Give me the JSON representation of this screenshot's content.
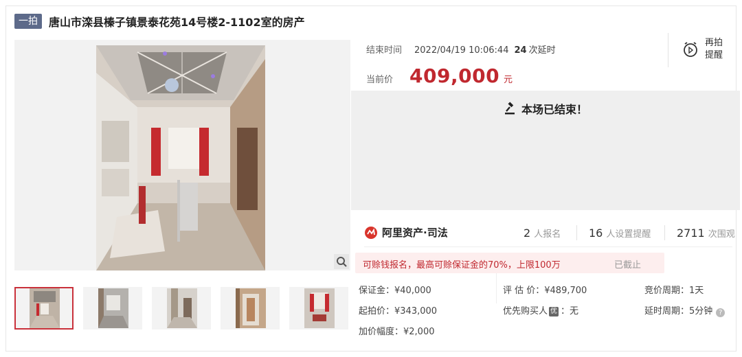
{
  "header": {
    "round_badge": "一拍",
    "title": "唐山市滦县榛子镇景泰花苑14号楼2-1102室的房产"
  },
  "gallery": {
    "thumbnail_count": 5,
    "selected_thumbnail": 1
  },
  "auction": {
    "end_label": "结束时间",
    "end_time": "2022/04/19 10:06:44",
    "delay_count": "24",
    "delay_label": "次延时",
    "price_label": "当前价",
    "price_value": "409,000",
    "price_unit": "元",
    "reminder_label": "再拍提醒",
    "ended_text": "本场已结束！"
  },
  "platform": {
    "name": "阿里资产·司法"
  },
  "stats": [
    {
      "value": "2",
      "label": "人报名"
    },
    {
      "value": "16",
      "label": "人设置提醒"
    },
    {
      "value": "2711",
      "label": "次围观"
    }
  ],
  "notice": {
    "text": "可赊钱报名，最高可赊保证金的70%，上限100万",
    "status": "已截止"
  },
  "details": {
    "deposit": "保证金：¥40,000",
    "appraisal": "评 估 价：¥489,700",
    "cycle": "竞价周期：1天",
    "starting_price": "起拍价：¥343,000",
    "priority_label": "优先购买人",
    "priority_badge": "优",
    "priority_value": "：无",
    "delay_cycle": "延时周期：5分钟",
    "increment": "加价幅度：¥2,000"
  },
  "colors": {
    "accent_red": "#c0282f",
    "badge_blue": "#5d6a8a",
    "thumb_selected": "#c9303a"
  }
}
